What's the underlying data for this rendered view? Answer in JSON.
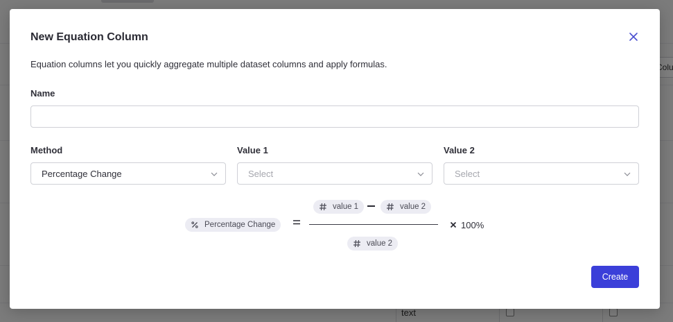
{
  "background": {
    "right_button_label": "Colu",
    "cell_text": "text"
  },
  "modal": {
    "title": "New Equation Column",
    "description": "Equation columns let you quickly aggregate multiple dataset columns and apply formulas.",
    "name_label": "Name",
    "name_value": "",
    "method_label": "Method",
    "method_value": "Percentage Change",
    "value1_label": "Value 1",
    "value1_placeholder": "Select",
    "value2_label": "Value 2",
    "value2_placeholder": "Select",
    "formula": {
      "result_chip": "Percentage Change",
      "numerator_left": "value 1",
      "numerator_right": "value 2",
      "denominator": "value 2",
      "multiplier": "100%"
    },
    "create_label": "Create",
    "accent_color": "#3b3fd9"
  }
}
